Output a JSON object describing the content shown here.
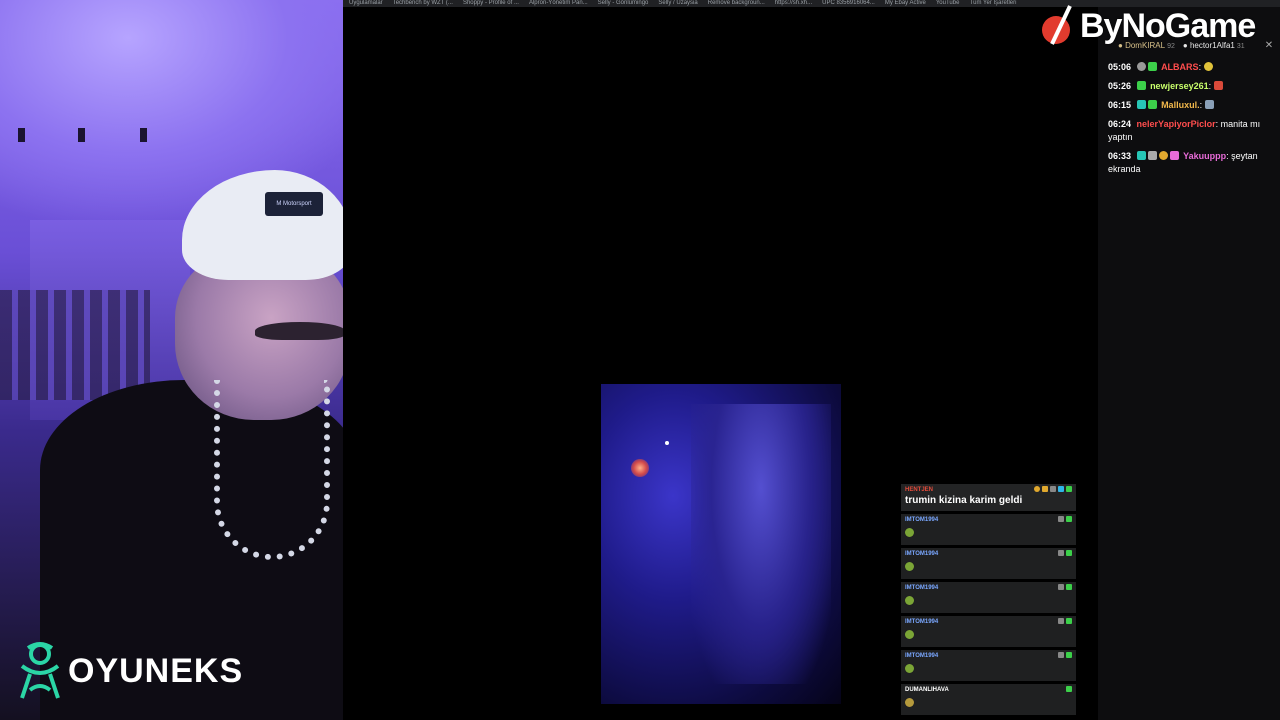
{
  "bookmarks": [
    "Uygulamalar",
    "Techbench by WZT (...",
    "Shoppy - Profile of ...",
    "Alpron-Yönetim Pan...",
    "Selly - Gönlümingo",
    "Selly / Üzaysia",
    "Remove backgroun...",
    "https://sh.xh...",
    "UPC 8356916064...",
    "My Ebay Active",
    "YouTube",
    "Tüm Yer İşaretleri"
  ],
  "webcam": {
    "cap_logo": "M Motorsport",
    "brand_text": "OYUNEKS"
  },
  "sponsor": {
    "text": "ByNoGame"
  },
  "top_users": [
    {
      "name": "DomKIRAL",
      "count": "92"
    },
    {
      "name": "hector1Alfa1",
      "count": "31"
    }
  ],
  "chat": [
    {
      "time": "05:06",
      "name": "ALBARS",
      "name_color": "#ff4d4d",
      "message": ""
    },
    {
      "time": "05:26",
      "name": "newjersey261",
      "name_color": "#c9ff6b",
      "message": ""
    },
    {
      "time": "06:15",
      "name": "Malluxul.",
      "name_color": "#f2b84b",
      "message": ""
    },
    {
      "time": "06:24",
      "name": "nelerYapiyorPiclor",
      "name_color": "#ff4d4d",
      "message": "manita mı yaptın"
    },
    {
      "time": "06:33",
      "name": "Yakuuppp",
      "name_color": "#e86bd8",
      "message": "şeytan ekranda"
    }
  ],
  "overlay_chat": [
    {
      "user": "HENTJEN",
      "user_color": "red",
      "message": "trumin kizina karim geldi",
      "emote": ""
    },
    {
      "user": "IMTOM1994",
      "user_color": "blue",
      "message": "",
      "emote": "green"
    },
    {
      "user": "IMTOM1994",
      "user_color": "blue",
      "message": "",
      "emote": "green"
    },
    {
      "user": "IMTOM1994",
      "user_color": "blue",
      "message": "",
      "emote": "green"
    },
    {
      "user": "IMTOM1994",
      "user_color": "blue",
      "message": "",
      "emote": "green"
    },
    {
      "user": "IMTOM1994",
      "user_color": "blue",
      "message": "",
      "emote": "green"
    },
    {
      "user": "DUMANLIHAVA",
      "user_color": "white",
      "message": "",
      "emote": "gold"
    }
  ],
  "colors": {
    "badge_green": "#3cd04a",
    "badge_gold": "#e0a82e",
    "badge_blue": "#2fb5e8",
    "badge_teal": "#27c6b6"
  }
}
